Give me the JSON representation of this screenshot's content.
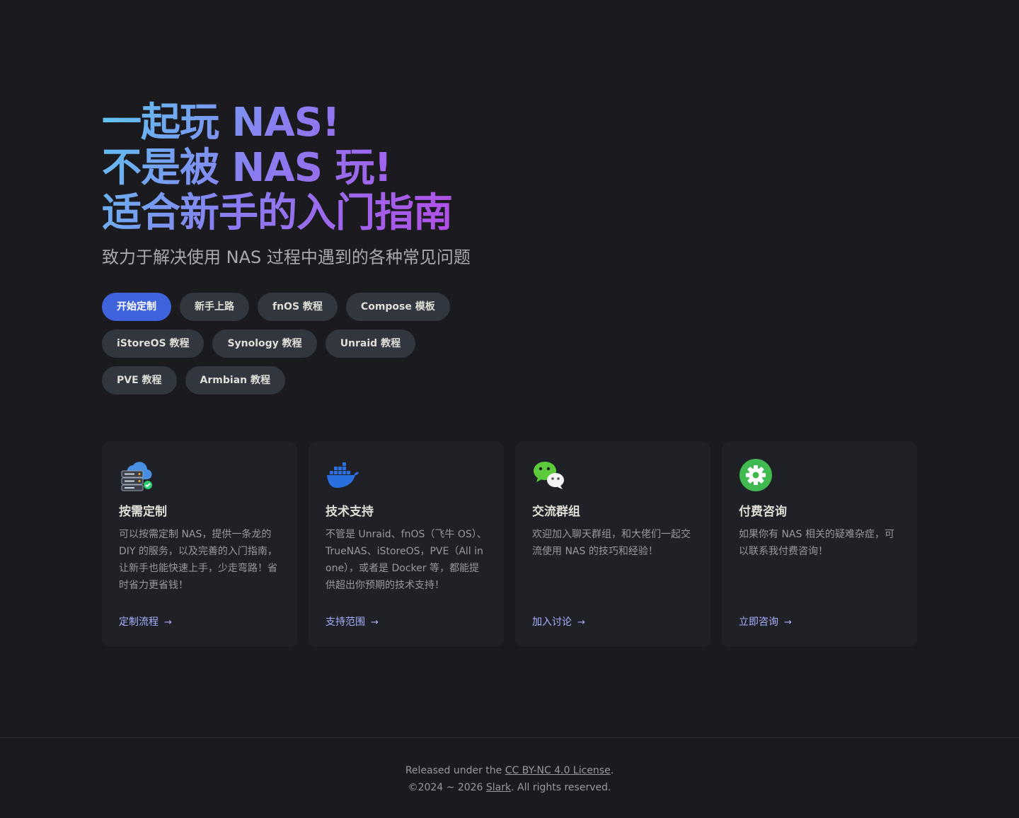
{
  "hero": {
    "title_line1": "一起玩 NAS!",
    "title_line2": "不是被 NAS 玩!",
    "title_line3": "适合新手的入门指南",
    "tagline": "致力于解决使用 NAS 过程中遇到的各种常见问题"
  },
  "actions": [
    {
      "label": "开始定制",
      "theme": "brand"
    },
    {
      "label": "新手上路",
      "theme": "alt"
    },
    {
      "label": "fnOS 教程",
      "theme": "alt"
    },
    {
      "label": "Compose 模板",
      "theme": "alt"
    },
    {
      "label": "iStoreOS 教程",
      "theme": "alt"
    },
    {
      "label": "Synology 教程",
      "theme": "alt"
    },
    {
      "label": "Unraid 教程",
      "theme": "alt"
    },
    {
      "label": "PVE 教程",
      "theme": "alt"
    },
    {
      "label": "Armbian 教程",
      "theme": "alt"
    }
  ],
  "features": [
    {
      "icon": "cloud-server-icon",
      "title": "按需定制",
      "details": "可以按需定制 NAS，提供一条龙的 DIY 的服务，以及完善的入门指南，让新手也能快速上手，少走弯路！省时省力更省钱！",
      "link": "定制流程"
    },
    {
      "icon": "docker-icon",
      "title": "技术支持",
      "details": "不管是 Unraid、fnOS（飞牛 OS）、TrueNAS、iStoreOS，PVE（All in one），或者是 Docker 等，都能提供超出你预期的技术支持！",
      "link": "支持范围"
    },
    {
      "icon": "wechat-icon",
      "title": "交流群组",
      "details": "欢迎加入聊天群组，和大佬们一起交流使用 NAS 的技巧和经验！",
      "link": "加入讨论"
    },
    {
      "icon": "gear-icon",
      "title": "付费咨询",
      "details": "如果你有 NAS 相关的疑难杂症，可以联系我付费咨询！",
      "link": "立即咨询"
    }
  ],
  "footer": {
    "released_prefix": "Released under the ",
    "license": "CC BY-NC 4.0 License",
    "released_suffix": ".",
    "copyright_prefix": "©2024 ~ 2026 ",
    "author": "Slark",
    "copyright_suffix": ". All rights reserved."
  },
  "colors": {
    "background": "#1b1b1f",
    "card": "#202127",
    "brand_button": "#3e63dd",
    "alt_button": "#32363f",
    "link": "#a8b1ff",
    "gradient_start": "#5ec8f2",
    "gradient_end": "#b34ee8"
  }
}
